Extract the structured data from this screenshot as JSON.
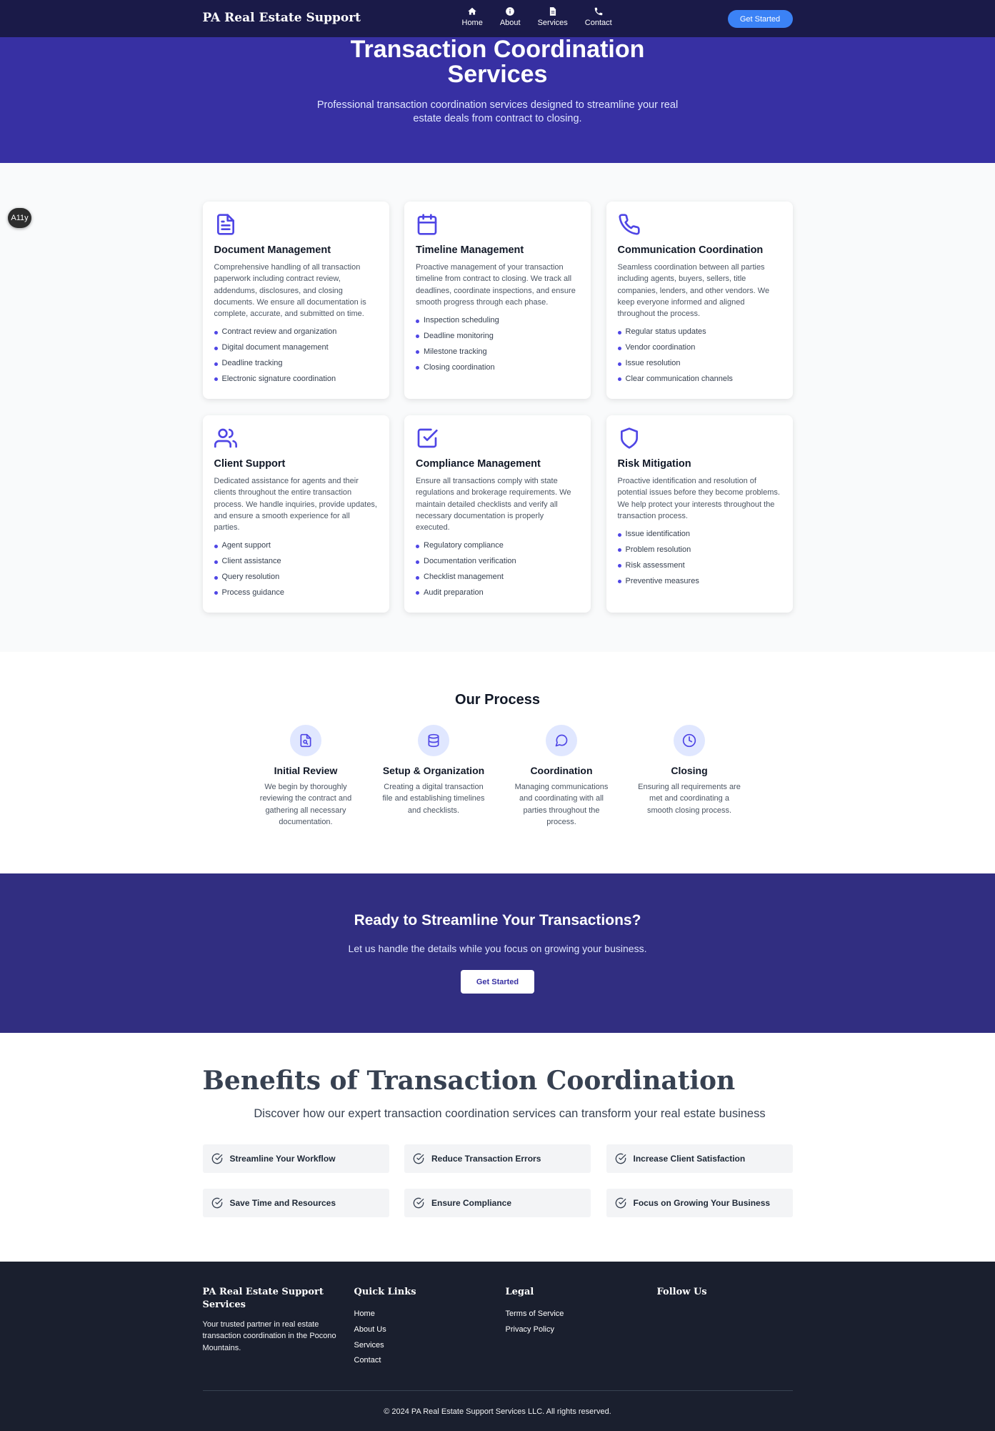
{
  "nav": {
    "brand": "PA Real Estate Support",
    "links": [
      {
        "label": "Home",
        "icon": "home-icon"
      },
      {
        "label": "About",
        "icon": "info-icon"
      },
      {
        "label": "Services",
        "icon": "document-icon"
      },
      {
        "label": "Contact",
        "icon": "phone-icon"
      }
    ],
    "cta": "Get Started"
  },
  "hero": {
    "title": "Transaction Coordination Services",
    "subtitle": "Professional transaction coordination services designed to streamline your real estate deals from contract to closing."
  },
  "a11y_label": "A11y",
  "services": [
    {
      "icon": "document-icon",
      "title": "Document Management",
      "description": "Comprehensive handling of all transaction paperwork including contract review, addendums, disclosures, and closing documents. We ensure all documentation is complete, accurate, and submitted on time.",
      "features": [
        "Contract review and organization",
        "Digital document management",
        "Deadline tracking",
        "Electronic signature coordination"
      ]
    },
    {
      "icon": "calendar-icon",
      "title": "Timeline Management",
      "description": "Proactive management of your transaction timeline from contract to closing. We track all deadlines, coordinate inspections, and ensure smooth progress through each phase.",
      "features": [
        "Inspection scheduling",
        "Deadline monitoring",
        "Milestone tracking",
        "Closing coordination"
      ]
    },
    {
      "icon": "phone-icon",
      "title": "Communication Coordination",
      "description": "Seamless coordination between all parties including agents, buyers, sellers, title companies, lenders, and other vendors. We keep everyone informed and aligned throughout the process.",
      "features": [
        "Regular status updates",
        "Vendor coordination",
        "Issue resolution",
        "Clear communication channels"
      ]
    },
    {
      "icon": "users-icon",
      "title": "Client Support",
      "description": "Dedicated assistance for agents and their clients throughout the entire transaction process. We handle inquiries, provide updates, and ensure a smooth experience for all parties.",
      "features": [
        "Agent support",
        "Client assistance",
        "Query resolution",
        "Process guidance"
      ]
    },
    {
      "icon": "check-square-icon",
      "title": "Compliance Management",
      "description": "Ensure all transactions comply with state regulations and brokerage requirements. We maintain detailed checklists and verify all necessary documentation is properly executed.",
      "features": [
        "Regulatory compliance",
        "Documentation verification",
        "Checklist management",
        "Audit preparation"
      ]
    },
    {
      "icon": "shield-icon",
      "title": "Risk Mitigation",
      "description": "Proactive identification and resolution of potential issues before they become problems. We help protect your interests throughout the transaction process.",
      "features": [
        "Issue identification",
        "Problem resolution",
        "Risk assessment",
        "Preventive measures"
      ]
    }
  ],
  "process": {
    "title": "Our Process",
    "steps": [
      {
        "icon": "file-search-icon",
        "title": "Initial Review",
        "description": "We begin by thoroughly reviewing the contract and gathering all necessary documentation."
      },
      {
        "icon": "database-icon",
        "title": "Setup & Organization",
        "description": "Creating a digital transaction file and establishing timelines and checklists."
      },
      {
        "icon": "message-circle-icon",
        "title": "Coordination",
        "description": "Managing communications and coordinating with all parties throughout the process."
      },
      {
        "icon": "clock-icon",
        "title": "Closing",
        "description": "Ensuring all requirements are met and coordinating a smooth closing process."
      }
    ]
  },
  "cta": {
    "title": "Ready to Streamline Your Transactions?",
    "subtitle": "Let us handle the details while you focus on growing your business.",
    "button": "Get Started"
  },
  "benefits": {
    "title": "Benefits of Transaction Coordination",
    "subtitle": "Discover how our expert transaction coordination services can transform your real estate business",
    "items": [
      "Streamline Your Workflow",
      "Reduce Transaction Errors",
      "Increase Client Satisfaction",
      "Save Time and Resources",
      "Ensure Compliance",
      "Focus on Growing Your Business"
    ]
  },
  "footer": {
    "brand": "PA Real Estate Support Services",
    "tagline": "Your trusted partner in real estate transaction coordination in the Pocono Mountains.",
    "quick_links_title": "Quick Links",
    "quick_links": [
      "Home",
      "About Us",
      "Services",
      "Contact"
    ],
    "legal_title": "Legal",
    "legal_links": [
      "Terms of Service",
      "Privacy Policy"
    ],
    "follow_title": "Follow Us",
    "copyright": "© 2024 PA Real Estate Support Services LLC. All rights reserved."
  }
}
